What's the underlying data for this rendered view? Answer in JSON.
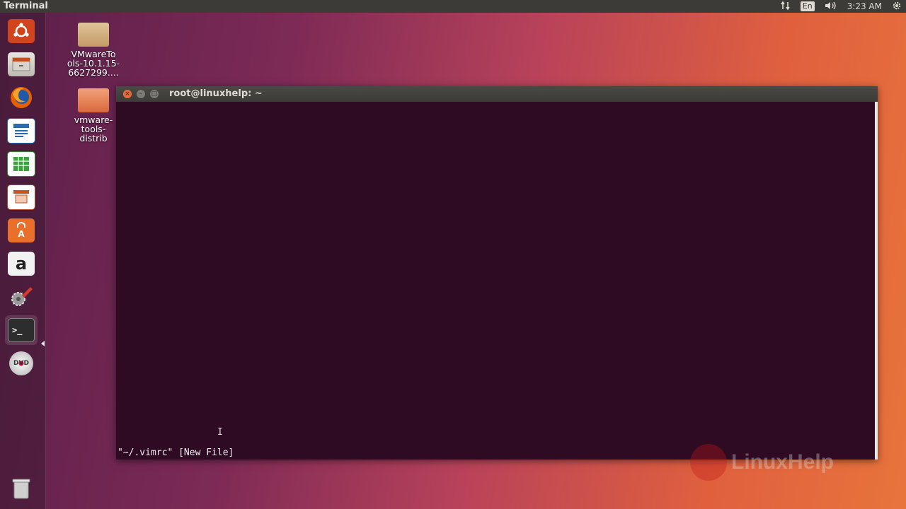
{
  "panel": {
    "app_title": "Terminal",
    "indicators": {
      "network_icon": "network-updown-icon",
      "keyboard_lang": "En",
      "sound_icon": "speaker-icon",
      "clock": "3:23 AM",
      "system_icon": "gear-icon"
    }
  },
  "launcher": {
    "items": [
      {
        "name": "ubuntu-dash",
        "icon": "ubuntu-logo-icon"
      },
      {
        "name": "files",
        "icon": "file-cabinet-icon"
      },
      {
        "name": "firefox",
        "icon": "firefox-icon"
      },
      {
        "name": "writer",
        "icon": "writer-doc-icon"
      },
      {
        "name": "calc",
        "icon": "spreadsheet-icon"
      },
      {
        "name": "impress",
        "icon": "presentation-icon"
      },
      {
        "name": "software-center",
        "icon": "shopping-bag-icon"
      },
      {
        "name": "amazon",
        "icon": "amazon-icon",
        "letter": "a"
      },
      {
        "name": "system-settings",
        "icon": "settings-tools-icon"
      },
      {
        "name": "terminal",
        "icon": "terminal-icon",
        "glyph": ">_"
      },
      {
        "name": "dvd",
        "icon": "dvd-icon",
        "glyph": "DVD"
      },
      {
        "name": "trash",
        "icon": "trash-icon"
      }
    ]
  },
  "desktop": {
    "icons": [
      {
        "label_lines": [
          "VMwareTo",
          "ols-10.1.15-",
          "6627299...."
        ],
        "type": "archive"
      },
      {
        "label_lines": [
          "vmware-",
          "tools-",
          "distrib"
        ],
        "type": "folder"
      }
    ]
  },
  "terminal": {
    "title": "root@linuxhelp: ~",
    "status_line": "\"~/.vimrc\" [New File]"
  },
  "watermark": {
    "text": "LinuxHelp"
  },
  "colors": {
    "terminal_bg": "#300a24",
    "panel_bg": "#3c3b37",
    "close_button": "#e66b3b"
  }
}
